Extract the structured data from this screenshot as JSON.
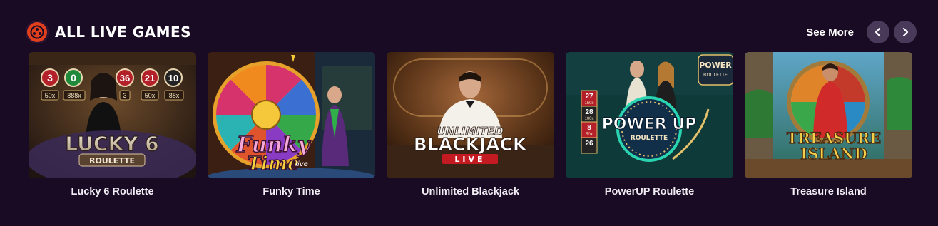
{
  "section": {
    "title": "ALL LIVE GAMES",
    "icon": "roulette-icon",
    "see_more_label": "See More"
  },
  "colors": {
    "background": "#1a0b24",
    "accent": "#e2401c",
    "nav_button": "#4a3a5a"
  },
  "games": [
    {
      "name": "Lucky 6 Roulette",
      "art": {
        "logo_line1": "LUCKY 6",
        "logo_line2": "ROULETTE",
        "numbers": [
          "3",
          "0",
          "36",
          "21",
          "10"
        ],
        "multipliers": [
          "50x",
          "888x",
          "3",
          "50x",
          "88x"
        ]
      }
    },
    {
      "name": "Funky Time",
      "art": {
        "logo_line1": "Funky",
        "logo_line2": "Time",
        "logo_line3": "live"
      }
    },
    {
      "name": "Unlimited Blackjack",
      "art": {
        "logo_line1": "UNLIMITED",
        "logo_line2": "BLACKJACK",
        "logo_line3": "LIVE"
      }
    },
    {
      "name": "PowerUP Roulette",
      "art": {
        "logo_line1": "POWER UP",
        "logo_line2": "ROULETTE",
        "corner_line1": "POWER",
        "corner_line2": "ROULETTE",
        "board_numbers": [
          "27",
          "28",
          "8",
          "26"
        ],
        "board_multipliers": [
          "150x",
          "100x",
          "50x"
        ]
      }
    },
    {
      "name": "Treasure Island",
      "art": {
        "logo_line1": "TREASURE",
        "logo_line2": "ISLAND"
      }
    }
  ]
}
